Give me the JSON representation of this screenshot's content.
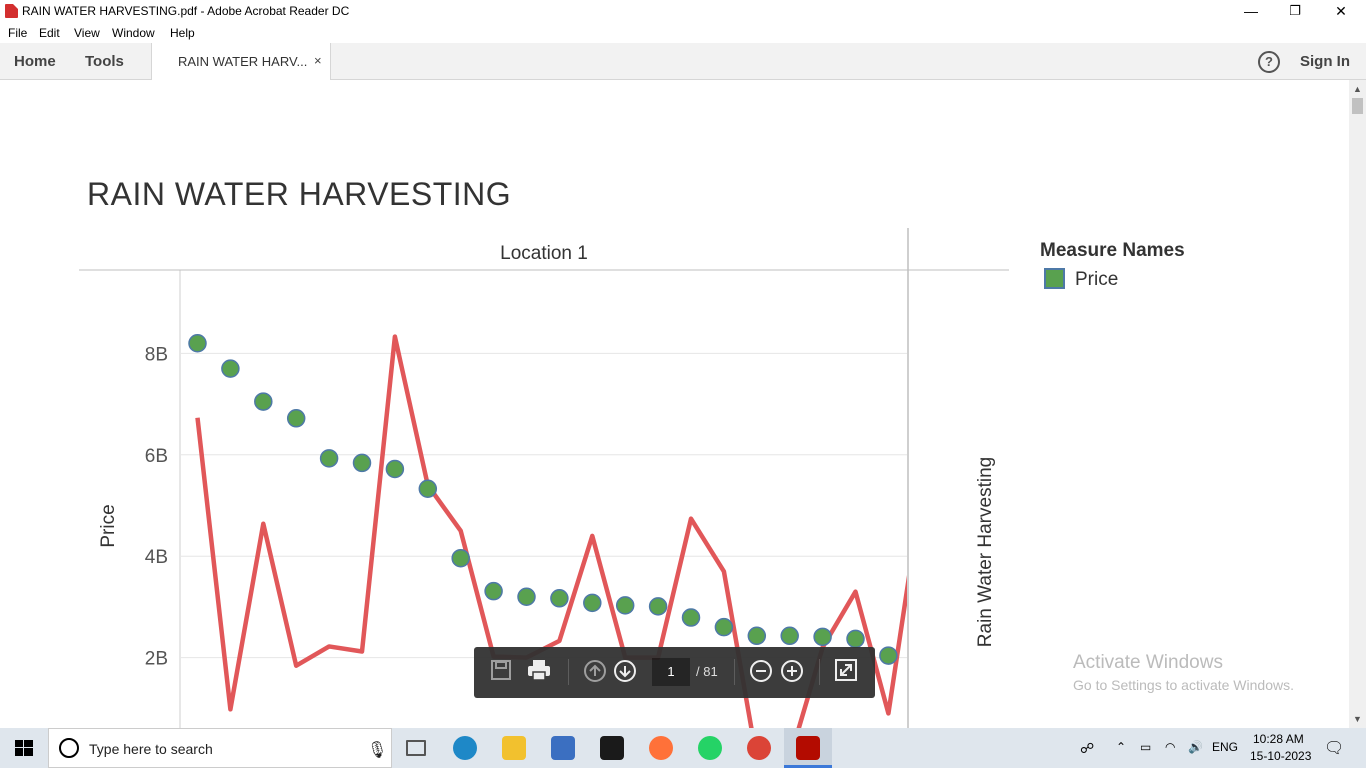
{
  "window": {
    "title": "RAIN WATER HARVESTING.pdf - Adobe Acrobat Reader DC",
    "minimize": "—",
    "restore": "❐",
    "close": "✕"
  },
  "menu": [
    "File",
    "Edit",
    "View",
    "Window",
    "Help"
  ],
  "toolbar": {
    "home": "Home",
    "tools": "Tools",
    "doc_tab": "RAIN WATER HARV...",
    "doc_tab_close": "×",
    "help": "?",
    "sign_in": "Sign In"
  },
  "report": {
    "title": "RAIN WATER HARVESTING"
  },
  "chart_data": {
    "type": "line",
    "title": "",
    "panel_header": "Location 1",
    "ylabel": "Price",
    "right_label": "Rain Water Harvesting",
    "yticks": [
      "2B",
      "4B",
      "6B",
      "8B"
    ],
    "ylim": [
      0,
      9.6
    ],
    "y_unit": "B",
    "grid": true,
    "legend_placement": "right",
    "legend_title": "Measure Names",
    "legend_entries": [
      "Price"
    ],
    "series": [
      {
        "name": "Price",
        "mark": "scatter",
        "color": "#59a14f",
        "values": [
          8.2,
          7.7,
          7.05,
          6.72,
          5.93,
          5.84,
          5.72,
          5.33,
          3.96,
          3.31,
          3.2,
          3.17,
          3.08,
          3.03,
          3.01,
          2.79,
          2.6,
          2.43,
          2.43,
          2.41,
          2.37,
          2.04
        ]
      },
      {
        "mark": "line",
        "color": "#e15759",
        "values": [
          6.73,
          0.98,
          4.64,
          1.84,
          2.22,
          2.12,
          8.33,
          5.4,
          4.5,
          2.02,
          2.0,
          2.33,
          4.4,
          2.0,
          2.0,
          4.74,
          3.7,
          0.0,
          0.0,
          2.2,
          3.3,
          0.9,
          5.2
        ]
      }
    ]
  },
  "pdf_toolbar": {
    "page_current": "1",
    "page_total": "/ 81"
  },
  "watermark": {
    "title": "Activate Windows",
    "subtitle": "Go to Settings to activate Windows."
  },
  "taskbar": {
    "search_placeholder": "Type here to search",
    "language": "ENG",
    "time": "10:28 AM",
    "date": "15-10-2023",
    "apps": [
      {
        "name": "task-view",
        "color": "#555555"
      },
      {
        "name": "edge",
        "color": "#1e88c7"
      },
      {
        "name": "file-explorer",
        "color": "#f2c12e"
      },
      {
        "name": "microsoft-store",
        "color": "#3b6fc1"
      },
      {
        "name": "mail",
        "color": "#1a1a1a"
      },
      {
        "name": "firefox",
        "color": "#ff7139"
      },
      {
        "name": "whatsapp",
        "color": "#25d366"
      },
      {
        "name": "chrome",
        "color": "#db4437"
      },
      {
        "name": "acrobat",
        "color": "#b30b00"
      }
    ]
  }
}
